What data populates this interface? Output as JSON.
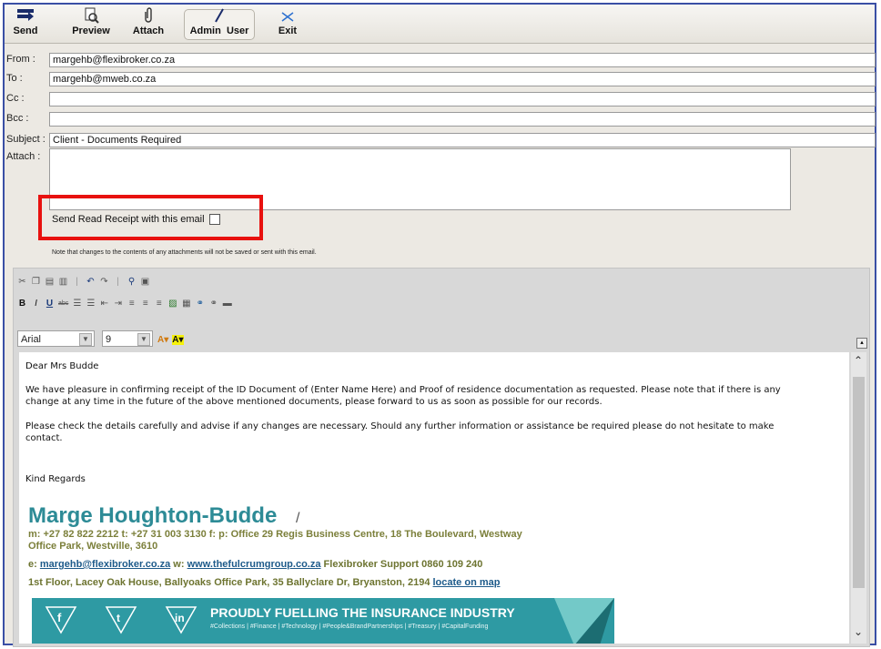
{
  "toolbar": {
    "send": "Send",
    "preview": "Preview",
    "attach": "Attach",
    "admin": "Admin",
    "user": "User",
    "exit": "Exit"
  },
  "fields": {
    "from_label": "From :",
    "from_value": "margehb@flexibroker.co.za",
    "to_label": "To :",
    "to_value": "margehb@mweb.co.za",
    "cc_label": "Cc :",
    "cc_value": "",
    "bcc_label": "Bcc :",
    "bcc_value": "",
    "subject_label": "Subject :",
    "subject_value": "Client - Documents Required",
    "attach_label": "Attach :"
  },
  "read_receipt": {
    "label": "Send Read Receipt with this email",
    "checked": false
  },
  "note": "Note that changes to the contents of any attachments will not be saved or sent with this email.",
  "format": {
    "font": "Arial",
    "size": "9"
  },
  "body": {
    "greeting": "Dear Mrs Budde",
    "p1_line1": "We have pleasure in confirming receipt of the ID Document of (Enter Name Here) and Proof of residence documentation as requested.  Please note that if there is any",
    "p1_line2": "change at any time in the future of the above mentioned documents, please forward to us as soon as possible for our records.",
    "p2_line1": "Please check the details carefully and advise if any changes are necessary.  Should any further information or assistance be required please do not hesitate to make",
    "p2_line2": "contact.",
    "closing": "Kind Regards"
  },
  "signature": {
    "name": "Marge Houghton-Budde",
    "slash": "/",
    "contact_line1": "m: +27 82 822 2212  t: +27 31 003 3130  f:   p: Office 29 Regis Business Centre, 18 The Boulevard, Westway",
    "contact_line2": "Office Park, Westville, 3610",
    "email_prefix": "e:",
    "email": "margehb@flexibroker.co.za",
    "web_prefix": "w:",
    "web": "www.thefulcrumgroup.co.za",
    "support": "Flexibroker Support 0860 109 240",
    "address": "1st Floor, Lacey Oak House, Ballyoaks Office Park, 35 Ballyclare Dr, Bryanston, 2194",
    "map_link": "locate on map"
  },
  "banner": {
    "title": "PROUDLY FUELLING THE INSURANCE INDUSTRY",
    "tags": "#Collections | #Finance | #Technology | #People&BrandPartnerships | #Treasury | #CapitalFunding",
    "social": [
      "f",
      "t",
      "in"
    ]
  },
  "colors": {
    "frame": "#3a4fa5",
    "highlight": "#e8110f",
    "signature": "#2d8b96",
    "banner": "#2e9aa3"
  }
}
